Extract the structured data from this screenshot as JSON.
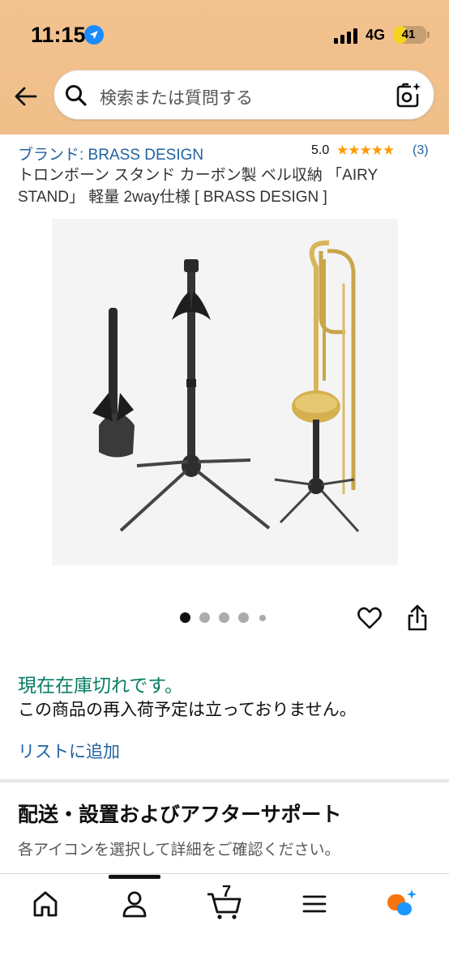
{
  "status_bar": {
    "time": "11:15",
    "network": "4G",
    "battery": "41",
    "battery_level": 0.41
  },
  "search": {
    "placeholder": "検索または質問する"
  },
  "product": {
    "brand": "ブランド: BRASS DESIGN",
    "rating": "5.0",
    "stars": "★★★★★",
    "rating_count": "(3)",
    "title": "トロンボーン スタンド カーボン製 ベル収納 「AIRY STAND」 軽量 2way仕様 [ BRASS DESIGN ]"
  },
  "gallery": {
    "total_images": 5,
    "active_index": 0
  },
  "availability": {
    "status": "現在在庫切れです。",
    "restock_note": "この商品の再入荷予定は立っておりません。",
    "add_to_list": "リストに追加"
  },
  "support_section": {
    "title": "配送・設置およびアフターサポート",
    "subtitle": "各アイコンを選択して詳細をご確認ください。"
  },
  "bottom_nav": {
    "cart_count": "7",
    "items": [
      "home-icon",
      "account-icon",
      "cart-icon",
      "menu-icon",
      "rufus-icon"
    ]
  },
  "colors": {
    "header": "#f2c28f",
    "link": "#2162a1",
    "in_stock_green": "#067d62",
    "star": "#ff9900",
    "rufus_orange": "#f7740f",
    "rufus_blue": "#1a98ff"
  }
}
